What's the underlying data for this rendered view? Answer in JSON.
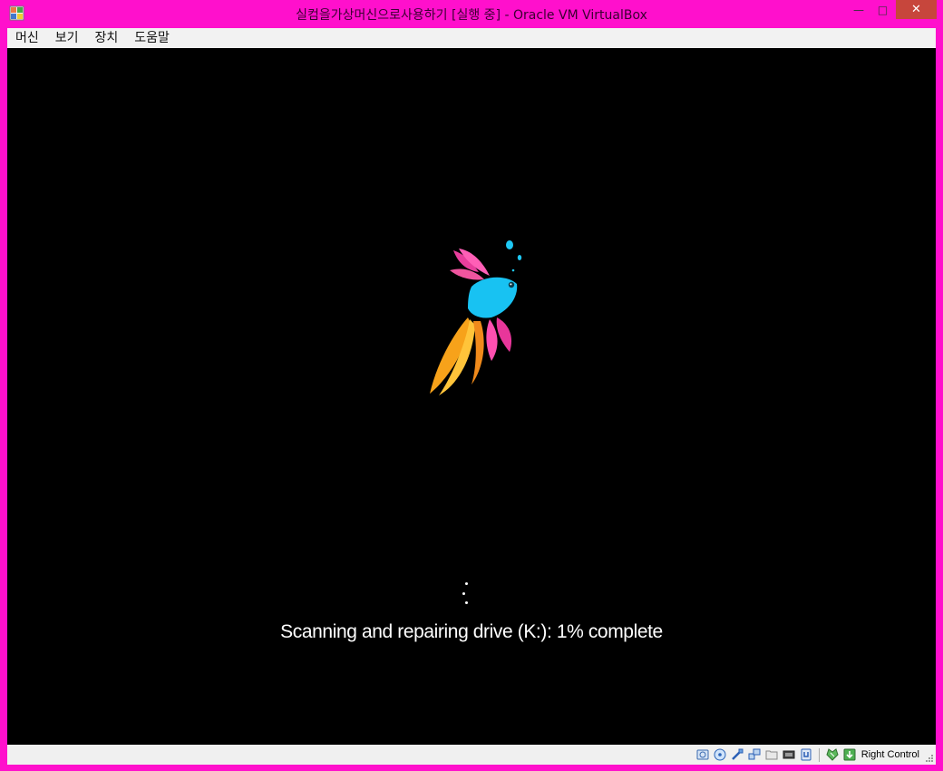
{
  "window": {
    "title": "실컴을가상머신으로사용하기 [실행 중] - Oracle VM VirtualBox",
    "frame_color": "#ff10cc",
    "close_symbol": "✕",
    "minimize_symbol": "—",
    "maximize_symbol": "□"
  },
  "menu": {
    "items": [
      "머신",
      "보기",
      "장치",
      "도움말"
    ]
  },
  "guest": {
    "status_text": "Scanning and repairing drive (K:): 1% complete",
    "background": "#000000"
  },
  "statusbar": {
    "icons": [
      "hard-disk-icon",
      "optical-drive-icon",
      "usb-icon",
      "network-icon",
      "shared-folders-icon",
      "video-capture-icon",
      "cpu-virtualization-icon",
      "mouse-integration-icon",
      "host-key-icon"
    ],
    "host_key_label": "Right Control"
  }
}
